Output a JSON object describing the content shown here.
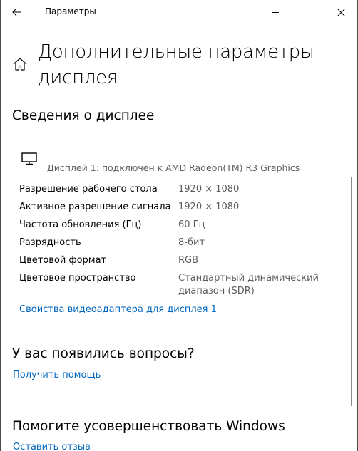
{
  "titlebar": {
    "app_title": "Параметры",
    "back_icon": "back-arrow-icon",
    "minimize_icon": "minimize-icon",
    "maximize_icon": "maximize-icon",
    "close_icon": "close-icon"
  },
  "page": {
    "home_icon": "home-icon",
    "title": "Дополнительные параметры дисплея"
  },
  "display_info": {
    "section_title": "Сведения о дисплее",
    "monitor_icon": "monitor-icon",
    "display_line": "Дисплей 1: подключен к AMD Radeon(TM) R3 Graphics",
    "rows": [
      {
        "label": "Разрешение рабочего стола",
        "value": "1920 × 1080"
      },
      {
        "label": "Активное разрешение сигнала",
        "value": "1920 × 1080"
      },
      {
        "label": "Частота обновления (Гц)",
        "value": "60 Гц"
      },
      {
        "label": "Разрядность",
        "value": "8-бит"
      },
      {
        "label": "Цветовой формат",
        "value": "RGB"
      },
      {
        "label": "Цветовое пространство",
        "value": "Стандартный динамический диапазон (SDR)"
      }
    ],
    "adapter_link": "Свойства видеоадаптера для дисплея 1"
  },
  "questions": {
    "section_title": "У вас появились вопросы?",
    "help_link": "Получить помощь"
  },
  "improve": {
    "section_title": "Помогите усовершенствовать Windows",
    "feedback_link": "Оставить отзыв"
  },
  "colors": {
    "link": "#0067c0",
    "secondary_text": "#5d5d5d"
  }
}
